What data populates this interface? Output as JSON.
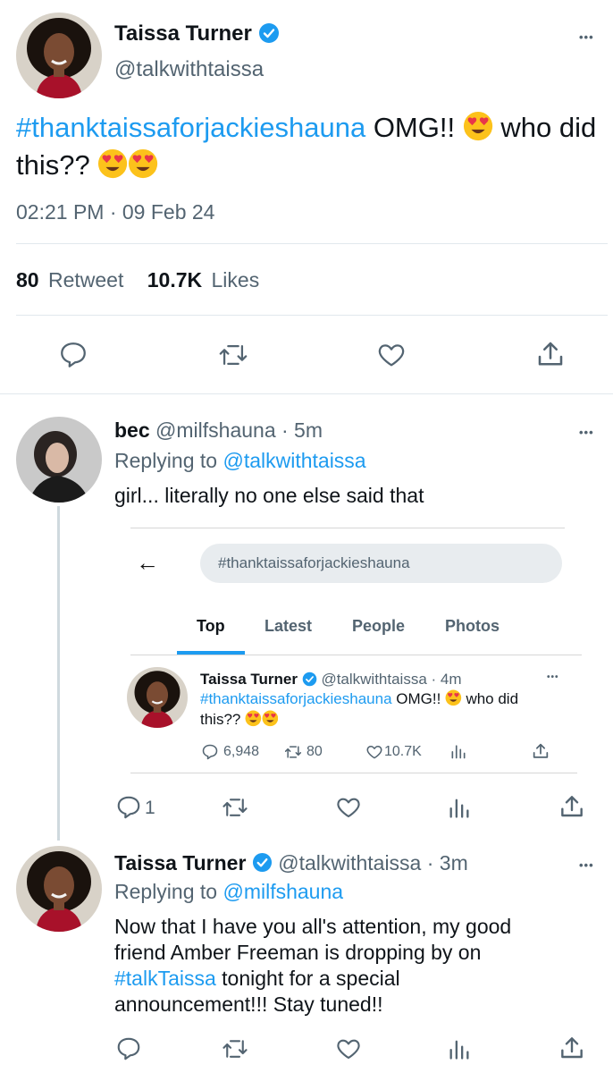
{
  "main_tweet": {
    "author_name": "Taissa Turner",
    "handle": "@talkwithtaissa",
    "hashtag": "#thanktaissaforjackieshauna",
    "text_part1": " OMG!! ",
    "text_part2": " who did this?? ",
    "timestamp": "02:21 PM · 09 Feb 24",
    "retweet_count": "80",
    "retweet_label": "Retweet",
    "likes_count": "10.7K",
    "likes_label": "Likes"
  },
  "reply1": {
    "author_name": "bec",
    "handle": "@milfshauna",
    "time": "· 5m",
    "replying_prefix": "Replying to ",
    "replying_handle": "@talkwithtaissa",
    "text": "girl... literally no one else said that",
    "reply_count": "1"
  },
  "embedded_screenshot": {
    "back_glyph": "←",
    "search_value": "#thanktaissaforjackieshauna",
    "tabs": [
      "Top",
      "Latest",
      "People",
      "Photos"
    ],
    "active_tab": "Top",
    "tweet": {
      "author_name": "Taissa Turner",
      "handle_time": "@talkwithtaissa · 4m",
      "hashtag": "#thanktaissaforjackieshauna",
      "text_part1": " OMG!! ",
      "text_part2": " who did",
      "text_line2": "this?? ",
      "reply_count": "6,948",
      "retweet_count": "80",
      "like_count": "10.7K"
    }
  },
  "reply2": {
    "author_name": "Taissa Turner",
    "handle": "@talkwithtaissa",
    "time": "· 3m",
    "replying_prefix": "Replying to ",
    "replying_handle": "@milfshauna",
    "line1": "Now that I have you all's attention, my good",
    "line2": "friend Amber Freeman is dropping by on",
    "line3_hashtag": "#talkTaissa",
    "line3_rest": " tonight for a special",
    "line4": "announcement!!! Stay tuned!!"
  },
  "more_glyph": "•••",
  "colors": {
    "accent": "#1d9bf0",
    "text": "#0f1419",
    "secondary": "#536471",
    "divider": "#e1e8ed"
  }
}
